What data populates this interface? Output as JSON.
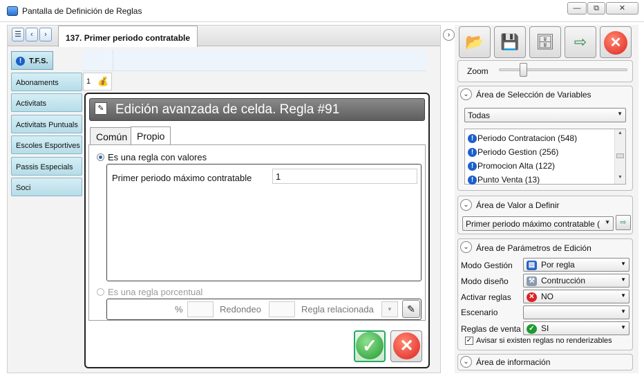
{
  "window": {
    "title": "Pantalla de Definición de Reglas",
    "btn_min": "—",
    "btn_restore": "⧉",
    "btn_close": "✕"
  },
  "tab": {
    "label": "137. Primer periodo contratable"
  },
  "sidebar": {
    "header": "T.F.S.",
    "items": [
      {
        "label": "Abonaments"
      },
      {
        "label": "Activitats"
      },
      {
        "label": "Activitats Puntuals"
      },
      {
        "label": "Escoles Esportives"
      },
      {
        "label": "Passis Especials"
      },
      {
        "label": "Soci"
      }
    ]
  },
  "grid": {
    "row_number": "1"
  },
  "dialog": {
    "title": "Edición avanzada de celda. Regla #91",
    "tabs": [
      {
        "label": "Común"
      },
      {
        "label": "Propio"
      }
    ],
    "radio_values_label": "Es una regla con valores",
    "field_label": "Primer periodo máximo contratable",
    "field_value": "1",
    "radio_percent_label": "Es una regla porcentual",
    "pct_label": "%",
    "redondeo_label": "Redondeo",
    "regla_rel_label": "Regla relacionada"
  },
  "right": {
    "zoom_label": "Zoom",
    "zoom_level": 0.2,
    "sel_section": {
      "title": "Área de Selección de Variables",
      "combo_value": "Todas",
      "items": [
        {
          "label": "Periodo Contratacion (548)"
        },
        {
          "label": "Periodo Gestion (256)"
        },
        {
          "label": "Promocion Alta (122)"
        },
        {
          "label": "Punto Venta (13)"
        }
      ]
    },
    "val_section": {
      "title": "Área de Valor a Definir",
      "combo_value": "Primer periodo máximo contratable ("
    },
    "param_section": {
      "title": "Área de Parámetros de Edición",
      "rows": [
        {
          "label": "Modo Gestión",
          "value": "Por regla"
        },
        {
          "label": "Modo diseño",
          "value": "Contrucción"
        },
        {
          "label": "Activar reglas",
          "value": "NO"
        },
        {
          "label": "Escenario",
          "value": ""
        },
        {
          "label": "Reglas de venta",
          "value": "SI"
        }
      ],
      "checkbox_label": "Avisar si existen reglas no renderizables"
    },
    "info_section": {
      "title": "Área de información"
    }
  },
  "colors": {
    "accent": "#1b5fcc",
    "ok": "#1f9a2f",
    "cancel": "#dd2222"
  }
}
